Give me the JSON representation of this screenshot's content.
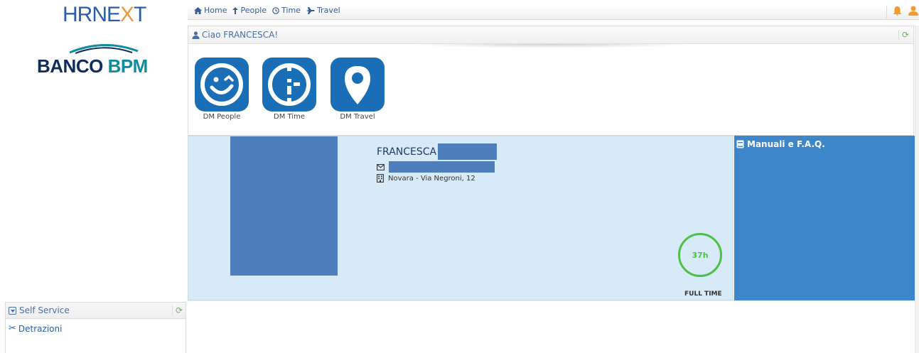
{
  "branding": {
    "hr_logo_left": "HRNE",
    "hr_logo_accent": "X",
    "hr_logo_right": "T",
    "bank_logo_main": "BANCO ",
    "bank_logo_accent": "BPM"
  },
  "topnav": {
    "items": [
      {
        "label": "Home",
        "icon": "home-icon"
      },
      {
        "label": "People",
        "icon": "pin-icon"
      },
      {
        "label": "Time",
        "icon": "clock-icon"
      },
      {
        "label": "Travel",
        "icon": "plane-icon"
      }
    ],
    "right_icons": [
      "bell-icon",
      "user-icon"
    ]
  },
  "welcome": {
    "greeting": "Ciao FRANCESCA!",
    "apps": [
      {
        "label": "DM People",
        "icon": "smile-icon"
      },
      {
        "label": "DM Time",
        "icon": "clock-face-icon"
      },
      {
        "label": "DM Travel",
        "icon": "map-pin-icon"
      }
    ]
  },
  "profile": {
    "first_name": "FRANCESCA",
    "address": "Novara - Via Negroni, 12",
    "weekly_hours": "37h",
    "work_type": "FULL TIME"
  },
  "manuali": {
    "title": "Manuali e F.A.Q."
  },
  "self_service": {
    "title": "Self Service",
    "items": [
      {
        "label": "Detrazioni",
        "icon": "scissors-icon"
      }
    ]
  },
  "colors": {
    "brand_blue": "#1a6eb6",
    "profile_bg": "#d6ebf7",
    "manuali_bg": "#3d86c9",
    "hours_ring": "#4fbf48",
    "notification_orange": "#f39a2b"
  }
}
